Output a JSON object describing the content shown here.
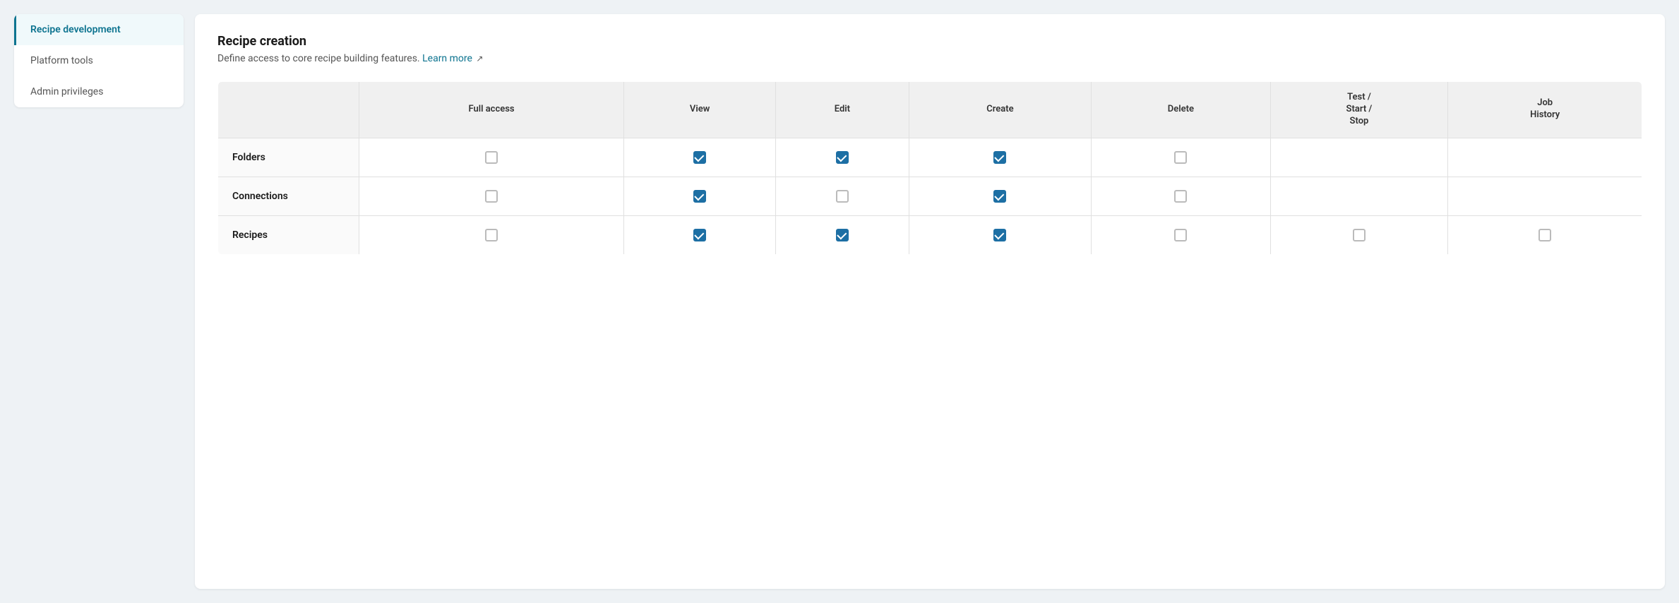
{
  "sidebar": {
    "items": [
      {
        "id": "recipe-development",
        "label": "Recipe development",
        "active": true
      },
      {
        "id": "platform-tools",
        "label": "Platform tools",
        "active": false
      },
      {
        "id": "admin-privileges",
        "label": "Admin privileges",
        "active": false
      }
    ]
  },
  "main": {
    "section_title": "Recipe creation",
    "section_desc": "Define access to core recipe building features.",
    "learn_more_label": "Learn more",
    "learn_more_href": "#",
    "table": {
      "columns": [
        {
          "id": "name",
          "label": ""
        },
        {
          "id": "full-access",
          "label": "Full access"
        },
        {
          "id": "view",
          "label": "View"
        },
        {
          "id": "edit",
          "label": "Edit"
        },
        {
          "id": "create",
          "label": "Create"
        },
        {
          "id": "delete",
          "label": "Delete"
        },
        {
          "id": "test-start-stop",
          "label": "Test /\nStart /\nStop"
        },
        {
          "id": "job-history",
          "label": "Job\nHistory"
        }
      ],
      "rows": [
        {
          "name": "Folders",
          "cells": {
            "full-access": false,
            "view": true,
            "edit": true,
            "create": true,
            "delete": false,
            "test-start-stop": null,
            "job-history": null
          }
        },
        {
          "name": "Connections",
          "cells": {
            "full-access": false,
            "view": true,
            "edit": false,
            "create": true,
            "delete": false,
            "test-start-stop": null,
            "job-history": null
          }
        },
        {
          "name": "Recipes",
          "cells": {
            "full-access": false,
            "view": true,
            "edit": true,
            "create": true,
            "delete": false,
            "test-start-stop": false,
            "job-history": false
          }
        }
      ]
    }
  },
  "colors": {
    "active_border": "#0e7490",
    "active_text": "#0e7490",
    "checkbox_checked": "#1d6fa4",
    "link": "#0e7490"
  }
}
